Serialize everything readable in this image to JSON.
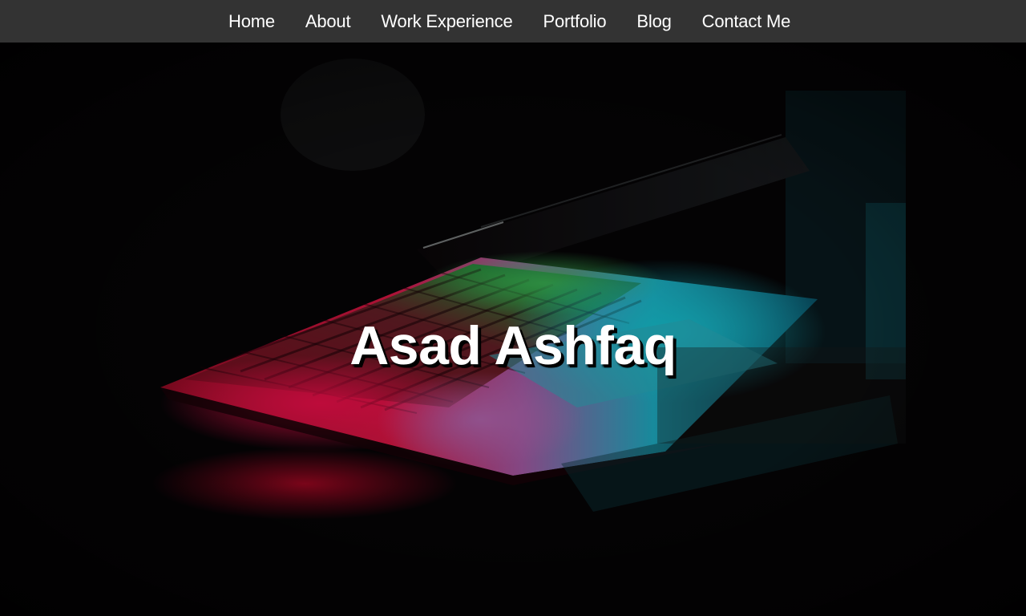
{
  "nav": {
    "items": [
      {
        "label": "Home"
      },
      {
        "label": "About"
      },
      {
        "label": "Work Experience"
      },
      {
        "label": "Portfolio"
      },
      {
        "label": "Blog"
      },
      {
        "label": "Contact Me"
      }
    ]
  },
  "hero": {
    "title": "Asad Ashfaq",
    "image": "laptop-keyboard-backlit-image"
  },
  "colors": {
    "navbar_bg": "#333333",
    "nav_text": "#ffffff",
    "hero_bg": "#050305",
    "keyboard_red": "#e0103a",
    "keyboard_green": "#2fb04a",
    "screen_cyan": "#10c8d8"
  }
}
